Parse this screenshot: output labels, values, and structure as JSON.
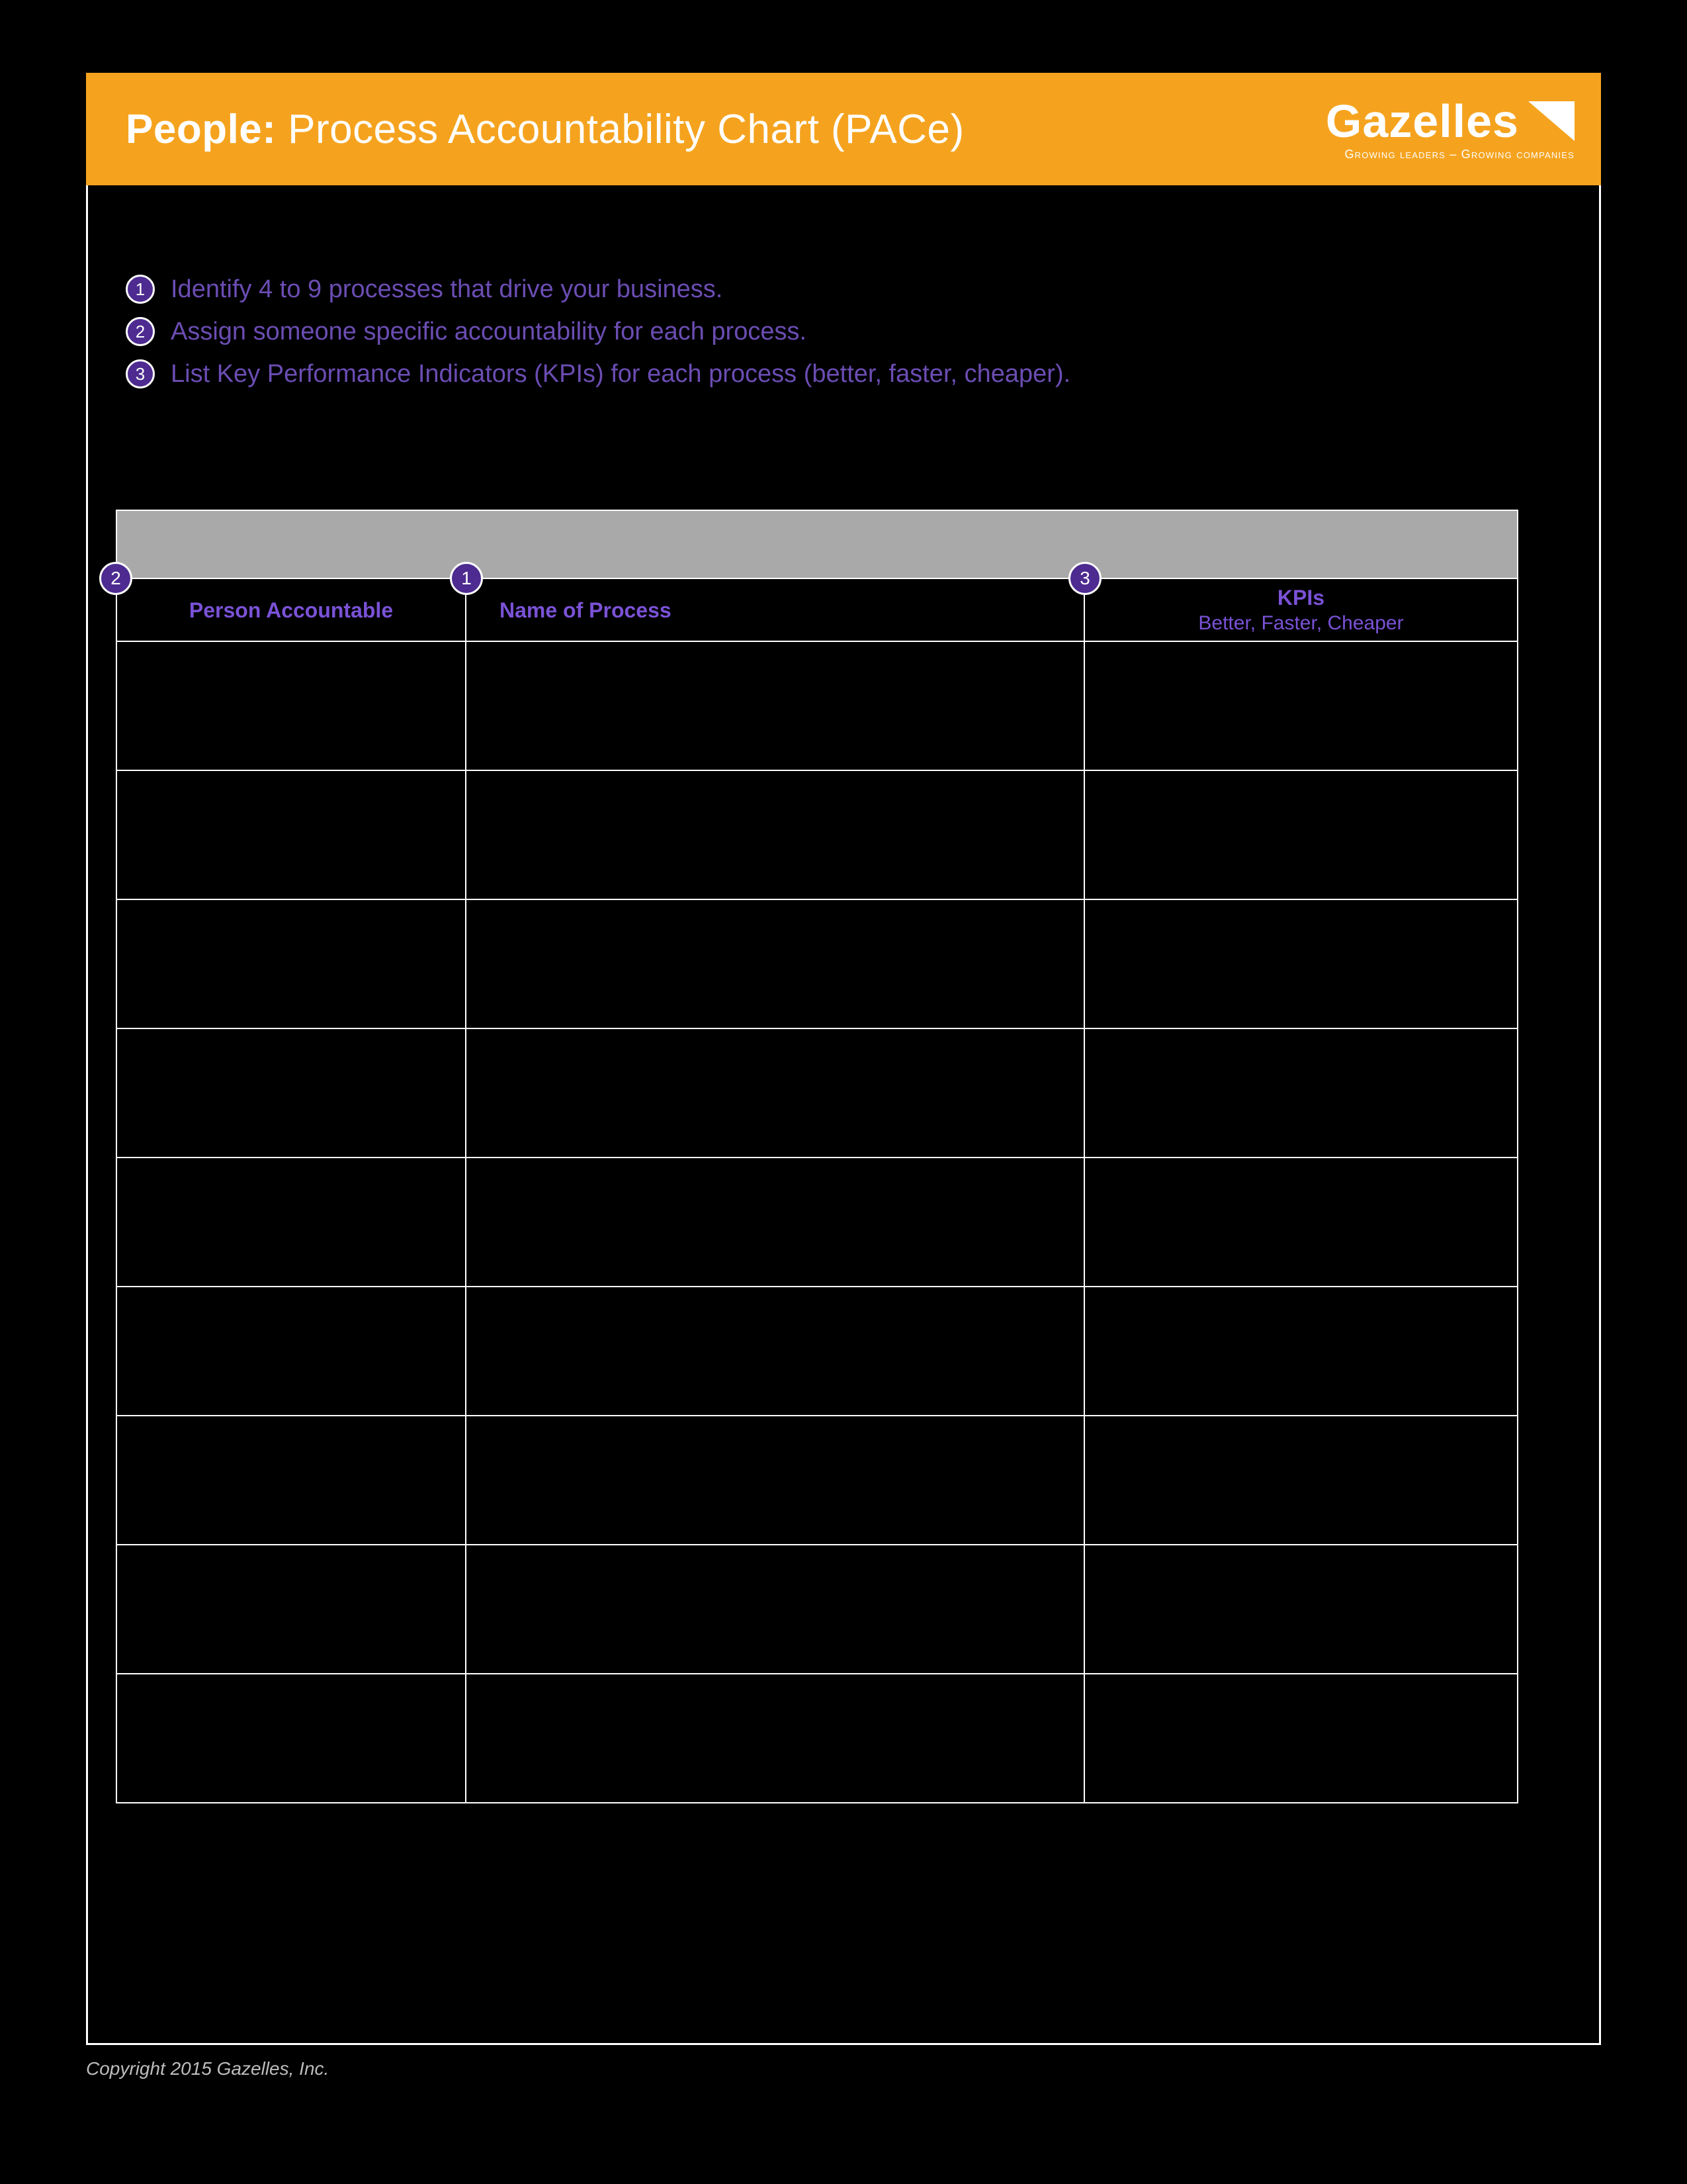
{
  "header": {
    "title_bold": "People:",
    "title_rest": " Process Accountability Chart (PACe)",
    "logo_text": "Gazelles",
    "tagline": "Growing leaders – Growing companies"
  },
  "instructions": [
    {
      "num": "1",
      "text": "Identify 4 to 9 processes that drive your business."
    },
    {
      "num": "2",
      "text": "Assign someone specific accountability for each process."
    },
    {
      "num": "3",
      "text": "List Key Performance Indicators (KPIs) for each process (better, faster, cheaper)."
    }
  ],
  "table": {
    "badges": {
      "col1": "2",
      "col2": "1",
      "col3": "3"
    },
    "head": {
      "col1": "Person Accountable",
      "col2": "Name of Process",
      "col3_top": "KPIs",
      "col3_sub": "Better, Faster, Cheaper"
    },
    "row_count": 9
  },
  "footer": "Copyright 2015 Gazelles, Inc."
}
